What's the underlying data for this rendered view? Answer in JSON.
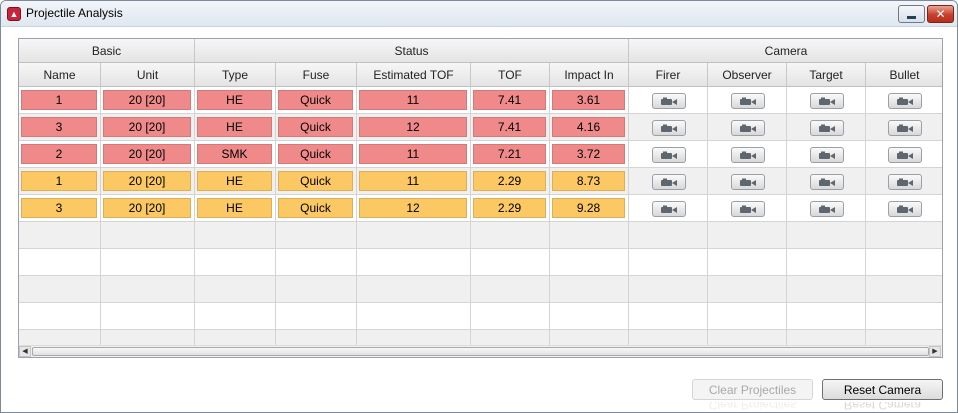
{
  "window": {
    "title": "Projectile Analysis",
    "icon": "app-logo-icon",
    "close_glyph": "✕"
  },
  "header_groups": [
    {
      "label": "Basic"
    },
    {
      "label": "Status"
    },
    {
      "label": "Camera"
    }
  ],
  "columns": [
    {
      "label": "Name"
    },
    {
      "label": "Unit"
    },
    {
      "label": "Type"
    },
    {
      "label": "Fuse"
    },
    {
      "label": "Estimated TOF"
    },
    {
      "label": "TOF"
    },
    {
      "label": "Impact In"
    },
    {
      "label": "Firer"
    },
    {
      "label": "Observer"
    },
    {
      "label": "Target"
    },
    {
      "label": "Bullet"
    }
  ],
  "rows": [
    {
      "status": "red",
      "cells": [
        "1",
        "20 [20]",
        "HE",
        "Quick",
        "11",
        "7.41",
        "3.61"
      ]
    },
    {
      "status": "red",
      "cells": [
        "3",
        "20 [20]",
        "HE",
        "Quick",
        "12",
        "7.41",
        "4.16"
      ]
    },
    {
      "status": "red",
      "cells": [
        "2",
        "20 [20]",
        "SMK",
        "Quick",
        "11",
        "7.21",
        "3.72"
      ]
    },
    {
      "status": "orange",
      "cells": [
        "1",
        "20 [20]",
        "HE",
        "Quick",
        "11",
        "2.29",
        "8.73"
      ]
    },
    {
      "status": "orange",
      "cells": [
        "3",
        "20 [20]",
        "HE",
        "Quick",
        "12",
        "2.29",
        "9.28"
      ]
    }
  ],
  "camera_button_icon": "camera-icon",
  "colors": {
    "red": "#f08a8a",
    "orange": "#fbc863",
    "accent": "#c8243d"
  },
  "scrollbar": {
    "left_arrow": "◀",
    "right_arrow": "▶"
  },
  "buttons": {
    "clear": "Clear Projectiles",
    "reset": "Reset Camera"
  }
}
